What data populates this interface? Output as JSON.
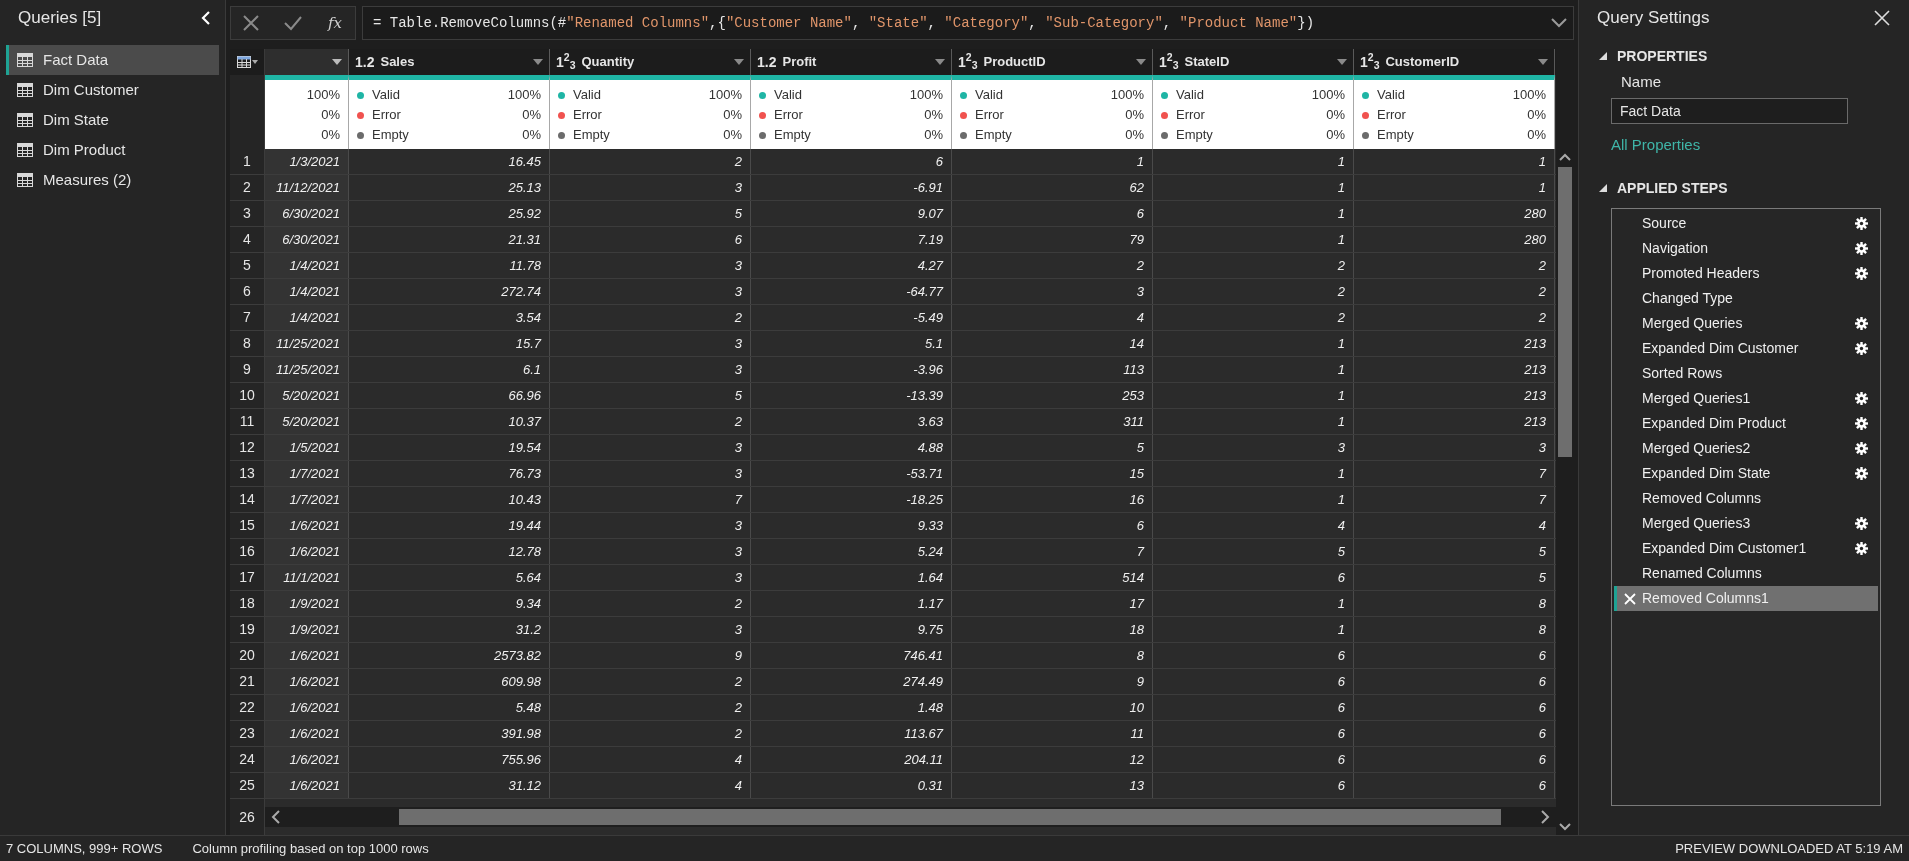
{
  "queries_panel": {
    "title": "Queries [5]",
    "items": [
      {
        "label": "Fact Data",
        "selected": true
      },
      {
        "label": "Dim Customer",
        "selected": false
      },
      {
        "label": "Dim State",
        "selected": false
      },
      {
        "label": "Dim Product",
        "selected": false
      },
      {
        "label": "Measures (2)",
        "selected": false
      }
    ]
  },
  "formula_bar": {
    "fx": "fx",
    "formula": [
      {
        "kind": "code",
        "text": "= Table.RemoveColumns(#"
      },
      {
        "kind": "string",
        "text": "\"Renamed Columns\""
      },
      {
        "kind": "code",
        "text": ",{"
      },
      {
        "kind": "string",
        "text": "\"Customer Name\""
      },
      {
        "kind": "code",
        "text": ", "
      },
      {
        "kind": "string",
        "text": "\"State\""
      },
      {
        "kind": "code",
        "text": ", "
      },
      {
        "kind": "string",
        "text": "\"Category\""
      },
      {
        "kind": "code",
        "text": ", "
      },
      {
        "kind": "string",
        "text": "\"Sub-Category\""
      },
      {
        "kind": "code",
        "text": ", "
      },
      {
        "kind": "string",
        "text": "\"Product Name\""
      },
      {
        "kind": "code",
        "text": "})"
      }
    ]
  },
  "table": {
    "columns": [
      {
        "profile": [
          {
            "value": "100%"
          },
          {
            "value": "0%"
          },
          {
            "value": "0%"
          }
        ]
      },
      {
        "type": "1.2",
        "name": "Sales",
        "profile": [
          {
            "label": "Valid",
            "value": "100%",
            "color": "#1fb5a5"
          },
          {
            "label": "Error",
            "value": "0%",
            "color": "#f0524f"
          },
          {
            "label": "Empty",
            "value": "0%",
            "color": "#6b6b6b"
          }
        ]
      },
      {
        "type": "1$^{2}$$_{3}$",
        "name": "Quantity",
        "profile": [
          {
            "label": "Valid",
            "value": "100%",
            "color": "#1fb5a5"
          },
          {
            "label": "Error",
            "value": "0%",
            "color": "#f0524f"
          },
          {
            "label": "Empty",
            "value": "0%",
            "color": "#6b6b6b"
          }
        ]
      },
      {
        "type": "1.2",
        "name": "Profit",
        "profile": [
          {
            "label": "Valid",
            "value": "100%",
            "color": "#1fb5a5"
          },
          {
            "label": "Error",
            "value": "0%",
            "color": "#f0524f"
          },
          {
            "label": "Empty",
            "value": "0%",
            "color": "#6b6b6b"
          }
        ]
      },
      {
        "type": "1$^{2}$$_{3}$",
        "name": "ProductID",
        "profile": [
          {
            "label": "Valid",
            "value": "100%",
            "color": "#1fb5a5"
          },
          {
            "label": "Error",
            "value": "0%",
            "color": "#f0524f"
          },
          {
            "label": "Empty",
            "value": "0%",
            "color": "#6b6b6b"
          }
        ]
      },
      {
        "type": "1$^{2}$$_{3}$",
        "name": "StateID",
        "profile": [
          {
            "label": "Valid",
            "value": "100%",
            "color": "#1fb5a5"
          },
          {
            "label": "Error",
            "value": "0%",
            "color": "#f0524f"
          },
          {
            "label": "Empty",
            "value": "0%",
            "color": "#6b6b6b"
          }
        ]
      },
      {
        "type": "1$^{2}$$_{3}$",
        "name": "CustomerID",
        "profile": [
          {
            "label": "Valid",
            "value": "100%",
            "color": "#1fb5a5"
          },
          {
            "label": "Error",
            "value": "0%",
            "color": "#f0524f"
          },
          {
            "label": "Empty",
            "value": "0%",
            "color": "#6b6b6b"
          }
        ]
      }
    ],
    "rows": [
      {
        "number": "1",
        "cells": [
          "1/3/2021",
          "16.45",
          "2",
          "6",
          "1",
          "1",
          "1"
        ]
      },
      {
        "number": "2",
        "cells": [
          "11/12/2021",
          "25.13",
          "3",
          "-6.91",
          "62",
          "1",
          "1"
        ]
      },
      {
        "number": "3",
        "cells": [
          "6/30/2021",
          "25.92",
          "5",
          "9.07",
          "6",
          "1",
          "280"
        ]
      },
      {
        "number": "4",
        "cells": [
          "6/30/2021",
          "21.31",
          "6",
          "7.19",
          "79",
          "1",
          "280"
        ]
      },
      {
        "number": "5",
        "cells": [
          "1/4/2021",
          "11.78",
          "3",
          "4.27",
          "2",
          "2",
          "2"
        ]
      },
      {
        "number": "6",
        "cells": [
          "1/4/2021",
          "272.74",
          "3",
          "-64.77",
          "3",
          "2",
          "2"
        ]
      },
      {
        "number": "7",
        "cells": [
          "1/4/2021",
          "3.54",
          "2",
          "-5.49",
          "4",
          "2",
          "2"
        ]
      },
      {
        "number": "8",
        "cells": [
          "11/25/2021",
          "15.7",
          "3",
          "5.1",
          "14",
          "1",
          "213"
        ]
      },
      {
        "number": "9",
        "cells": [
          "11/25/2021",
          "6.1",
          "3",
          "-3.96",
          "113",
          "1",
          "213"
        ]
      },
      {
        "number": "10",
        "cells": [
          "5/20/2021",
          "66.96",
          "5",
          "-13.39",
          "253",
          "1",
          "213"
        ]
      },
      {
        "number": "11",
        "cells": [
          "5/20/2021",
          "10.37",
          "2",
          "3.63",
          "311",
          "1",
          "213"
        ]
      },
      {
        "number": "12",
        "cells": [
          "1/5/2021",
          "19.54",
          "3",
          "4.88",
          "5",
          "3",
          "3"
        ]
      },
      {
        "number": "13",
        "cells": [
          "1/7/2021",
          "76.73",
          "3",
          "-53.71",
          "15",
          "1",
          "7"
        ]
      },
      {
        "number": "14",
        "cells": [
          "1/7/2021",
          "10.43",
          "7",
          "-18.25",
          "16",
          "1",
          "7"
        ]
      },
      {
        "number": "15",
        "cells": [
          "1/6/2021",
          "19.44",
          "3",
          "9.33",
          "6",
          "4",
          "4"
        ]
      },
      {
        "number": "16",
        "cells": [
          "1/6/2021",
          "12.78",
          "3",
          "5.24",
          "7",
          "5",
          "5"
        ]
      },
      {
        "number": "17",
        "cells": [
          "11/1/2021",
          "5.64",
          "3",
          "1.64",
          "514",
          "6",
          "5"
        ]
      },
      {
        "number": "18",
        "cells": [
          "1/9/2021",
          "9.34",
          "2",
          "1.17",
          "17",
          "1",
          "8"
        ]
      },
      {
        "number": "19",
        "cells": [
          "1/9/2021",
          "31.2",
          "3",
          "9.75",
          "18",
          "1",
          "8"
        ]
      },
      {
        "number": "20",
        "cells": [
          "1/6/2021",
          "2573.82",
          "9",
          "746.41",
          "8",
          "6",
          "6"
        ]
      },
      {
        "number": "21",
        "cells": [
          "1/6/2021",
          "609.98",
          "2",
          "274.49",
          "9",
          "6",
          "6"
        ]
      },
      {
        "number": "22",
        "cells": [
          "1/6/2021",
          "5.48",
          "2",
          "1.48",
          "10",
          "6",
          "6"
        ]
      },
      {
        "number": "23",
        "cells": [
          "1/6/2021",
          "391.98",
          "2",
          "113.67",
          "11",
          "6",
          "6"
        ]
      },
      {
        "number": "24",
        "cells": [
          "1/6/2021",
          "755.96",
          "4",
          "204.11",
          "12",
          "6",
          "6"
        ]
      },
      {
        "number": "25",
        "cells": [
          "1/6/2021",
          "31.12",
          "4",
          "0.31",
          "13",
          "6",
          "6"
        ]
      }
    ],
    "partial_row_number": "26"
  },
  "query_settings": {
    "title": "Query Settings",
    "properties": {
      "heading": "PROPERTIES",
      "name_label": "Name",
      "name_value": "Fact Data",
      "link": "All Properties"
    },
    "applied_steps": {
      "heading": "APPLIED STEPS",
      "steps": [
        {
          "label": "Source",
          "has_settings": true,
          "selected": false
        },
        {
          "label": "Navigation",
          "has_settings": true,
          "selected": false
        },
        {
          "label": "Promoted Headers",
          "has_settings": true,
          "selected": false
        },
        {
          "label": "Changed Type",
          "has_settings": false,
          "selected": false
        },
        {
          "label": "Merged Queries",
          "has_settings": true,
          "selected": false
        },
        {
          "label": "Expanded Dim Customer",
          "has_settings": true,
          "selected": false
        },
        {
          "label": "Sorted Rows",
          "has_settings": false,
          "selected": false
        },
        {
          "label": "Merged Queries1",
          "has_settings": true,
          "selected": false
        },
        {
          "label": "Expanded Dim Product",
          "has_settings": true,
          "selected": false
        },
        {
          "label": "Merged Queries2",
          "has_settings": true,
          "selected": false
        },
        {
          "label": "Expanded Dim State",
          "has_settings": true,
          "selected": false
        },
        {
          "label": "Removed Columns",
          "has_settings": false,
          "selected": false
        },
        {
          "label": "Merged Queries3",
          "has_settings": true,
          "selected": false
        },
        {
          "label": "Expanded Dim Customer1",
          "has_settings": true,
          "selected": false
        },
        {
          "label": "Renamed Columns",
          "has_settings": false,
          "selected": false
        },
        {
          "label": "Removed Columns1",
          "has_settings": false,
          "selected": true
        }
      ]
    }
  },
  "status_bar": {
    "left": "7 COLUMNS, 999+ ROWS",
    "middle": "Column profiling based on top 1000 rows",
    "right": "PREVIEW DOWNLOADED AT 5:19 AM"
  }
}
